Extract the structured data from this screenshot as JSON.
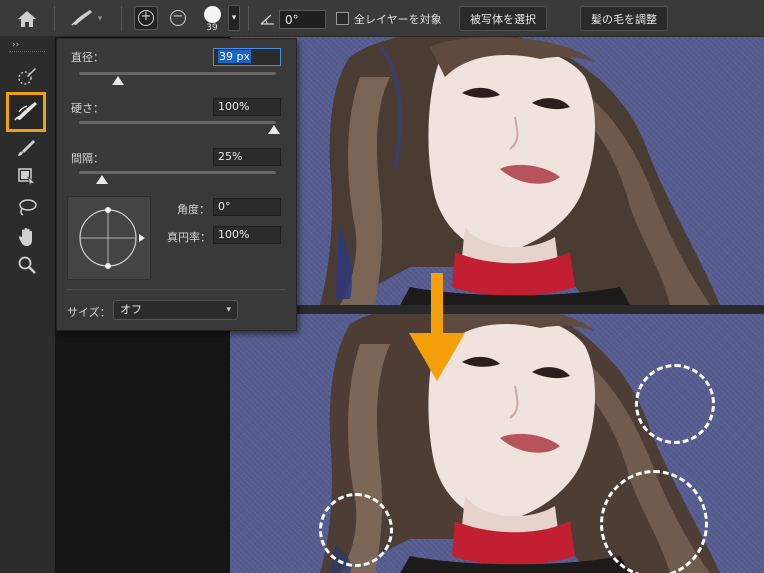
{
  "options_bar": {
    "brush_size_preview": "39",
    "angle_value": "0°",
    "all_layers_label": "全レイヤーを対象",
    "select_subject_label": "被写体を選択",
    "refine_hair_label": "髪の毛を調整"
  },
  "brush_popup": {
    "diameter_label": "直径：",
    "diameter_value": "39 px",
    "diameter_fraction": 0.19,
    "hardness_label": "硬さ：",
    "hardness_value": "100%",
    "hardness_fraction": 1.0,
    "spacing_label": "間隔：",
    "spacing_value": "25%",
    "spacing_fraction": 0.11,
    "angle_label": "角度：",
    "angle_value": "0°",
    "roundness_label": "真円率：",
    "roundness_value": "100%",
    "size_label": "サイズ：",
    "size_value": "オフ"
  },
  "toolbar": {
    "collapse_glyph": "››",
    "tools": [
      "quick-selection-tool",
      "refine-edge-brush-tool",
      "brush-tool",
      "object-selection-tool",
      "lasso-tool",
      "hand-tool",
      "zoom-tool"
    ],
    "selected_tool": "refine-edge-brush-tool"
  },
  "colors": {
    "accent_highlight": "#f0a00c",
    "arrow": "#f5a00a",
    "photo_background": "#565c90",
    "selection_blue": "#1a64c8"
  }
}
